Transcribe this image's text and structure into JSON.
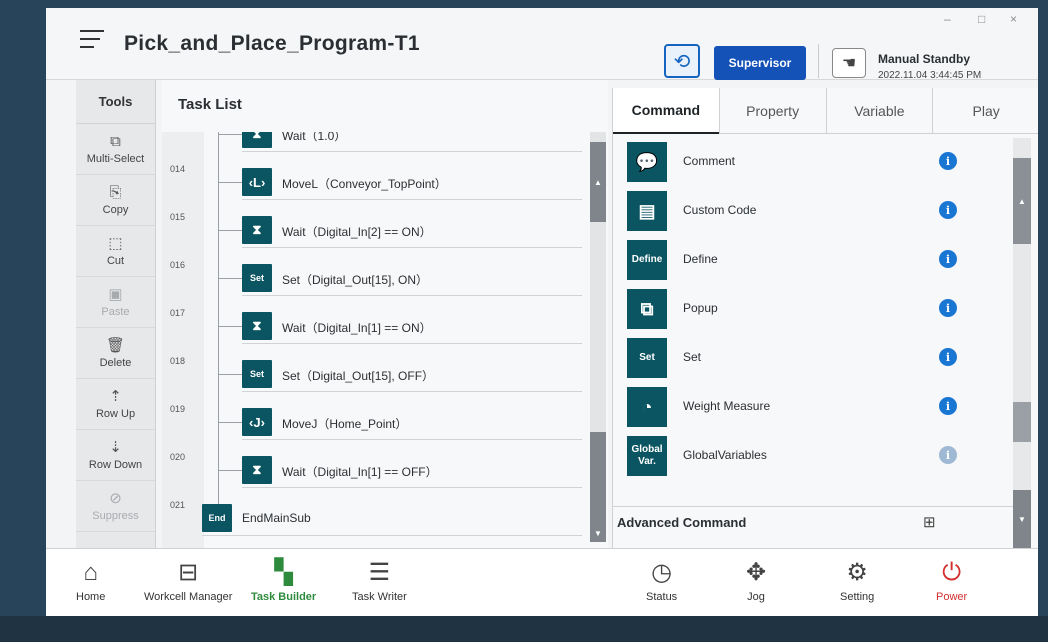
{
  "window": {
    "title": "Pick_and_Place_Program-T1",
    "controls": [
      "–",
      "□",
      "×"
    ]
  },
  "header": {
    "sync_icon": "sync-icon",
    "supervisor_label": "Supervisor",
    "mode_icon": "hand-icon",
    "mode": "Manual Standby",
    "datetime": "2022.11.04 3:44:45 PM"
  },
  "tools": {
    "title": "Tools",
    "items": [
      {
        "label": "Multi-Select",
        "icon": "multi-select-icon",
        "glyph": "⧉",
        "enabled": true
      },
      {
        "label": "Copy",
        "icon": "copy-icon",
        "glyph": "⎘",
        "enabled": true
      },
      {
        "label": "Cut",
        "icon": "cut-icon",
        "glyph": "⬚",
        "enabled": true
      },
      {
        "label": "Paste",
        "icon": "paste-icon",
        "glyph": "▣",
        "enabled": false
      },
      {
        "label": "Delete",
        "icon": "trash-icon",
        "glyph": "🗑",
        "enabled": true
      },
      {
        "label": "Row Up",
        "icon": "row-up-icon",
        "glyph": "⇡",
        "enabled": true
      },
      {
        "label": "Row Down",
        "icon": "row-down-icon",
        "glyph": "⇣",
        "enabled": true
      },
      {
        "label": "Suppress",
        "icon": "suppress-icon",
        "glyph": "⊘",
        "enabled": false
      }
    ]
  },
  "tasklist": {
    "title": "Task List",
    "rows": [
      {
        "num": "",
        "badge": "⧗",
        "badge_type": "icon",
        "text": "Wait（1.0）"
      },
      {
        "num": "014",
        "badge": "‹L›",
        "badge_type": "icon",
        "text": "MoveL（Conveyor_TopPoint）"
      },
      {
        "num": "015",
        "badge": "⧗",
        "badge_type": "icon",
        "text": "Wait（Digital_In[2] == ON）"
      },
      {
        "num": "016",
        "badge": "Set",
        "badge_type": "text",
        "text": "Set（Digital_Out[15], ON）"
      },
      {
        "num": "017",
        "badge": "⧗",
        "badge_type": "icon",
        "text": "Wait（Digital_In[1] == ON）"
      },
      {
        "num": "018",
        "badge": "Set",
        "badge_type": "text",
        "text": "Set（Digital_Out[15], OFF）"
      },
      {
        "num": "019",
        "badge": "‹J›",
        "badge_type": "icon",
        "text": "MoveJ（Home_Point）"
      },
      {
        "num": "020",
        "badge": "⧗",
        "badge_type": "icon",
        "text": "Wait（Digital_In[1] == OFF）"
      }
    ],
    "end_row": {
      "num": "021",
      "badge": "End",
      "text": "EndMainSub"
    }
  },
  "panel": {
    "tabs": [
      {
        "label": "Command",
        "active": true
      },
      {
        "label": "Property",
        "active": false
      },
      {
        "label": "Variable",
        "active": false
      },
      {
        "label": "Play",
        "active": false
      }
    ],
    "commands": [
      {
        "name": "Comment",
        "badge": "💬",
        "badge_type": "icon",
        "icon": "comment-icon",
        "info_enabled": true
      },
      {
        "name": "Custom Code",
        "badge": "▤",
        "badge_type": "icon",
        "icon": "custom-code-icon",
        "info_enabled": true
      },
      {
        "name": "Define",
        "badge": "Define",
        "badge_type": "text",
        "icon": "define-icon",
        "info_enabled": true
      },
      {
        "name": "Popup",
        "badge": "⧉",
        "badge_type": "icon",
        "icon": "popup-icon",
        "info_enabled": true
      },
      {
        "name": "Set",
        "badge": "Set",
        "badge_type": "text",
        "icon": "set-icon",
        "info_enabled": true
      },
      {
        "name": "Weight Measure",
        "badge": "◔",
        "badge_type": "icon",
        "icon": "gauge-icon",
        "info_enabled": true
      },
      {
        "name": "GlobalVariables",
        "badge": "Global Var.",
        "badge_type": "text",
        "icon": "global-var-icon",
        "info_enabled": false
      }
    ],
    "advanced_label": "Advanced Command",
    "grid_icon": "grid-icon"
  },
  "nav": [
    {
      "label": "Home",
      "icon": "home-icon",
      "glyph": "⌂",
      "state": "normal"
    },
    {
      "label": "Workcell Manager",
      "icon": "workcell-icon",
      "glyph": "⊟",
      "state": "normal"
    },
    {
      "label": "Task Builder",
      "icon": "task-builder-icon",
      "glyph": "▚",
      "state": "active"
    },
    {
      "label": "Task Writer",
      "icon": "task-writer-icon",
      "glyph": "☰",
      "state": "normal"
    },
    {
      "label": "Status",
      "icon": "status-icon",
      "glyph": "◷",
      "state": "normal"
    },
    {
      "label": "Jog",
      "icon": "jog-icon",
      "glyph": "✥",
      "state": "normal"
    },
    {
      "label": "Setting",
      "icon": "gear-icon",
      "glyph": "⚙",
      "state": "normal"
    },
    {
      "label": "Power",
      "icon": "power-icon",
      "glyph": "⏻",
      "state": "power"
    }
  ]
}
